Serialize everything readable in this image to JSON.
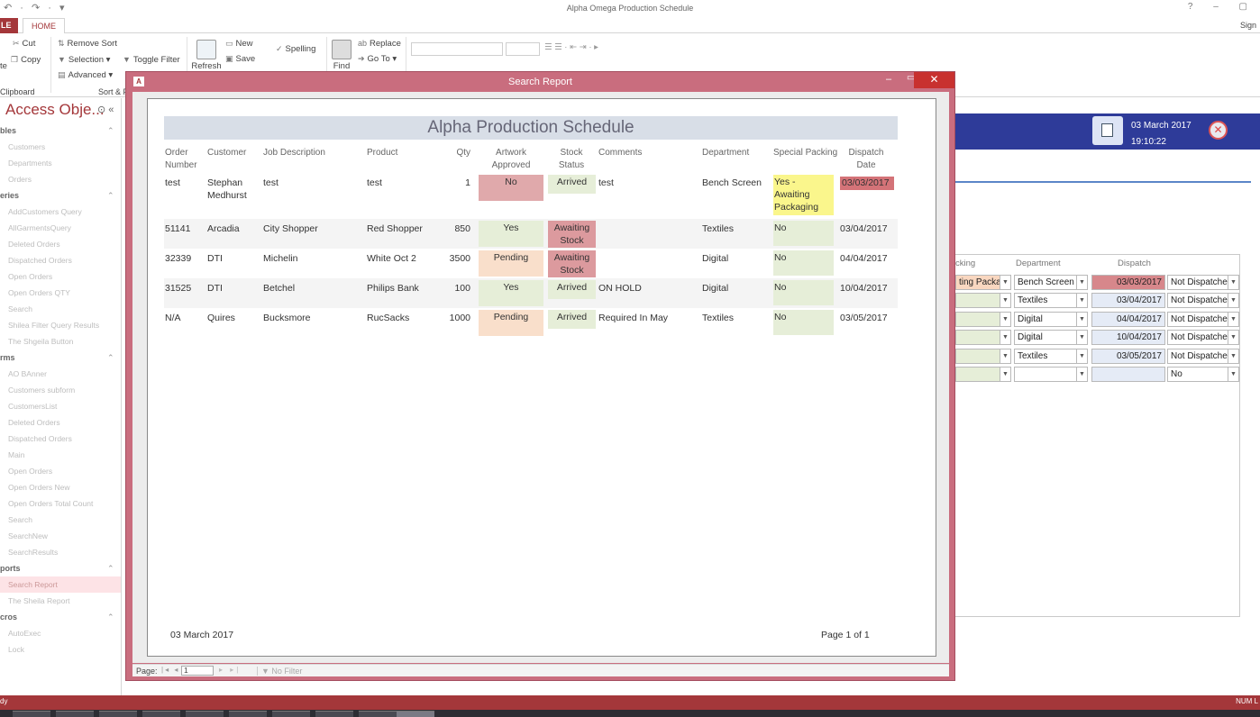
{
  "app": {
    "title": "Alpha Omega Production Schedule",
    "qat": "↶ · ↷ · ▾",
    "win_controls": "? – ▢",
    "sign_in": "Sign"
  },
  "tabs": {
    "file": "LE",
    "home": "HOME"
  },
  "ribbon": {
    "cut": "Cut",
    "copy": "Copy",
    "paste_fragment": "te",
    "clipboard_group": "Clipboard",
    "remove_sort": "Remove Sort",
    "selection": "Selection ▾",
    "advanced": "Advanced ▾",
    "toggle_filter": "Toggle Filter",
    "sort_group": "Sort & F",
    "refresh": "Refresh",
    "new": "New",
    "save": "Save",
    "spelling": "Spelling",
    "find": "Find",
    "replace": "Replace",
    "goto": "Go To ▾"
  },
  "nav": {
    "header": "Access Obje...",
    "items": [
      {
        "label": "bles",
        "type": "cat"
      },
      {
        "label": "Customers",
        "type": "item"
      },
      {
        "label": "Departments",
        "type": "item"
      },
      {
        "label": "Orders",
        "type": "item"
      },
      {
        "label": "eries",
        "type": "cat"
      },
      {
        "label": "AddCustomers Query",
        "type": "item"
      },
      {
        "label": "AllGarmentsQuery",
        "type": "item"
      },
      {
        "label": "Deleted Orders",
        "type": "item"
      },
      {
        "label": "Dispatched Orders",
        "type": "item"
      },
      {
        "label": "Open Orders",
        "type": "item"
      },
      {
        "label": "Open Orders QTY",
        "type": "item"
      },
      {
        "label": "Search",
        "type": "item"
      },
      {
        "label": "Shilea Filter Query Results",
        "type": "item"
      },
      {
        "label": "The Shgeila Button",
        "type": "item"
      },
      {
        "label": "rms",
        "type": "cat"
      },
      {
        "label": "AO BAnner",
        "type": "item"
      },
      {
        "label": "Customers subform",
        "type": "item"
      },
      {
        "label": "CustomersList",
        "type": "item"
      },
      {
        "label": "Deleted Orders",
        "type": "item"
      },
      {
        "label": "Dispatched Orders",
        "type": "item"
      },
      {
        "label": "Main",
        "type": "item"
      },
      {
        "label": "Open Orders",
        "type": "item"
      },
      {
        "label": "Open Orders New",
        "type": "item"
      },
      {
        "label": "Open Orders Total Count",
        "type": "item"
      },
      {
        "label": "Search",
        "type": "item"
      },
      {
        "label": "SearchNew",
        "type": "item"
      },
      {
        "label": "SearchResults",
        "type": "item"
      },
      {
        "label": "ports",
        "type": "cat"
      },
      {
        "label": "Search Report",
        "type": "sel"
      },
      {
        "label": "The Sheila Report",
        "type": "item"
      },
      {
        "label": "cros",
        "type": "cat"
      },
      {
        "label": "AutoExec",
        "type": "item"
      },
      {
        "label": "Lock",
        "type": "item"
      }
    ]
  },
  "background_form": {
    "date": "03 March 2017",
    "time": "19:10:22",
    "columns": [
      "cking",
      "Department",
      "Dispatch"
    ],
    "rows": [
      {
        "packing": "ting Packa",
        "department": "Bench Screen",
        "dispatch": "03/03/2017",
        "status": "Not Dispatche"
      },
      {
        "packing": "",
        "department": "Textiles",
        "dispatch": "03/04/2017",
        "status": "Not Dispatche"
      },
      {
        "packing": "",
        "department": "Digital",
        "dispatch": "04/04/2017",
        "status": "Not Dispatche"
      },
      {
        "packing": "",
        "department": "Digital",
        "dispatch": "10/04/2017",
        "status": "Not Dispatche"
      },
      {
        "packing": "",
        "department": "Textiles",
        "dispatch": "03/05/2017",
        "status": "Not Dispatche"
      },
      {
        "packing": "",
        "department": "",
        "dispatch": "",
        "status": "No"
      }
    ]
  },
  "report_window": {
    "title": "Search Report",
    "app_icon": "A",
    "page_label": "Page:",
    "page_value": "1",
    "no_filter": "No Filter"
  },
  "report": {
    "title": "Alpha Production Schedule",
    "headers": {
      "order": "Order Number",
      "customer": "Customer",
      "job": "Job Description",
      "product": "Product",
      "qty": "Qty",
      "artwork": "Artwork Approved",
      "stock": "Stock Status",
      "comments": "Comments",
      "department": "Department",
      "packing": "Special Packing",
      "dispatch": "Dispatch Date"
    },
    "rows": [
      {
        "order": "test",
        "customer": "Stephan Medhurst",
        "job": "test",
        "product": "test",
        "qty": "1",
        "artwork": "No",
        "stock": "Arrived",
        "comments": "test",
        "department": "Bench Screen",
        "packing": "Yes - Awaiting Packaging",
        "dispatch": "03/03/2017"
      },
      {
        "order": "51141",
        "customer": "Arcadia",
        "job": "City Shopper",
        "product": "Red Shopper",
        "qty": "850",
        "artwork": "Yes",
        "stock": "Awaiting Stock",
        "comments": "",
        "department": "Textiles",
        "packing": "No",
        "dispatch": "03/04/2017"
      },
      {
        "order": "32339",
        "customer": "DTI",
        "job": "Michelin",
        "product": "White Oct 2",
        "qty": "3500",
        "artwork": "Pending",
        "stock": "Awaiting Stock",
        "comments": "",
        "department": "Digital",
        "packing": "No",
        "dispatch": "04/04/2017"
      },
      {
        "order": "31525",
        "customer": "DTI",
        "job": "Betchel",
        "product": "Philips Bank",
        "qty": "100",
        "artwork": "Yes",
        "stock": "Arrived",
        "comments": "ON HOLD",
        "department": "Digital",
        "packing": "No",
        "dispatch": "10/04/2017"
      },
      {
        "order": "N/A",
        "customer": "Quires",
        "job": "Bucksmore",
        "product": "RucSacks",
        "qty": "1000",
        "artwork": "Pending",
        "stock": "Arrived",
        "comments": "Required In May",
        "department": "Textiles",
        "packing": "No",
        "dispatch": "03/05/2017"
      }
    ],
    "footer_date": "03 March 2017",
    "footer_page": "Page 1 of 1"
  },
  "statusbar": {
    "left": "dy",
    "right": "NUM L"
  },
  "colors": {
    "accent": "#a4373a",
    "modal_frame": "#c96d7e",
    "form_header": "#2e3b99"
  }
}
